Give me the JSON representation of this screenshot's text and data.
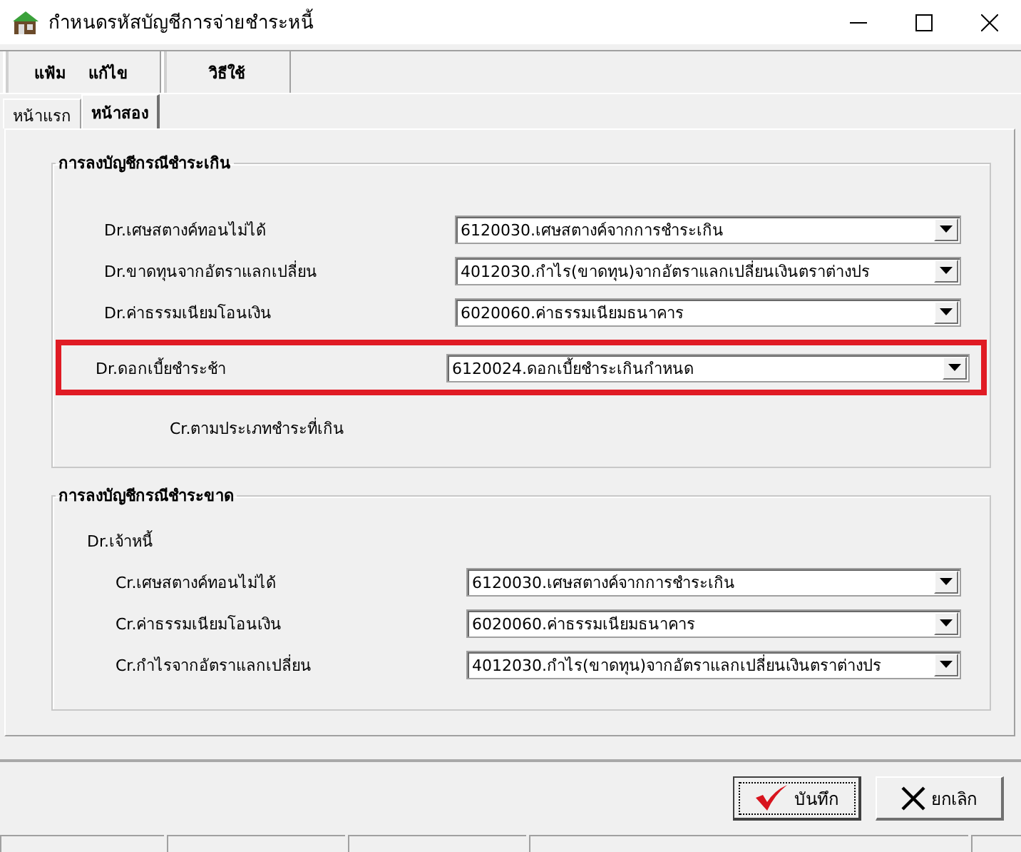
{
  "window": {
    "title": "กำหนดรหัสบัญชีการจ่ายชำระหนี้"
  },
  "toolbar": [
    {
      "items": [
        "แฟ้ม",
        "แก้ไข"
      ]
    },
    {
      "items": [
        "วิธีใช้"
      ]
    }
  ],
  "tabs": [
    {
      "label": "หน้าแรก",
      "selected": false
    },
    {
      "label": "หน้าสอง",
      "selected": true
    }
  ],
  "groups": [
    {
      "title": "การลงบัญชีกรณีชำระเกิน",
      "rows": [
        {
          "kind": "combo",
          "label": "Dr.เศษสตางค์ทอนไม่ได้",
          "value": "6120030.เศษสตางค์จากการชำระเกิน",
          "highlighted": false
        },
        {
          "kind": "combo",
          "label": "Dr.ขาดทุนจากอัตราแลกเปลี่ยน",
          "value": "4012030.กำไร(ขาดทุน)จากอัตราแลกเปลี่ยนเงินตราต่างปร",
          "highlighted": false
        },
        {
          "kind": "combo",
          "label": "Dr.ค่าธรรมเนียมโอนเงิน",
          "value": "6020060.ค่าธรรมเนียมธนาคาร",
          "highlighted": false
        },
        {
          "kind": "combo",
          "label": "Dr.ดอกเบี้ยชำระช้า",
          "value": "6120024.ดอกเบี้ยชำระเกินกำหนด",
          "highlighted": true
        },
        {
          "kind": "note",
          "label": "Cr.ตามประเภทชำระที่เกิน"
        }
      ]
    },
    {
      "title": "การลงบัญชีกรณีชำระขาด",
      "rows": [
        {
          "kind": "heading",
          "label": "Dr.เจ้าหนี้"
        },
        {
          "kind": "combo",
          "label": "Cr.เศษสตางค์ทอนไม่ได้",
          "value": "6120030.เศษสตางค์จากการชำระเกิน",
          "highlighted": false
        },
        {
          "kind": "combo",
          "label": "Cr.ค่าธรรมเนียมโอนเงิน",
          "value": "6020060.ค่าธรรมเนียมธนาคาร",
          "highlighted": false
        },
        {
          "kind": "combo",
          "label": "Cr.กำไรจากอัตราแลกเปลี่ยน",
          "value": "4012030.กำไร(ขาดทุน)จากอัตราแลกเปลี่ยนเงินตราต่างปร",
          "highlighted": false
        }
      ]
    }
  ],
  "buttons": [
    {
      "kind": "save",
      "label": "บันทึก",
      "selected": true
    },
    {
      "kind": "cancel",
      "label": "ยกเลิก",
      "selected": false
    }
  ]
}
